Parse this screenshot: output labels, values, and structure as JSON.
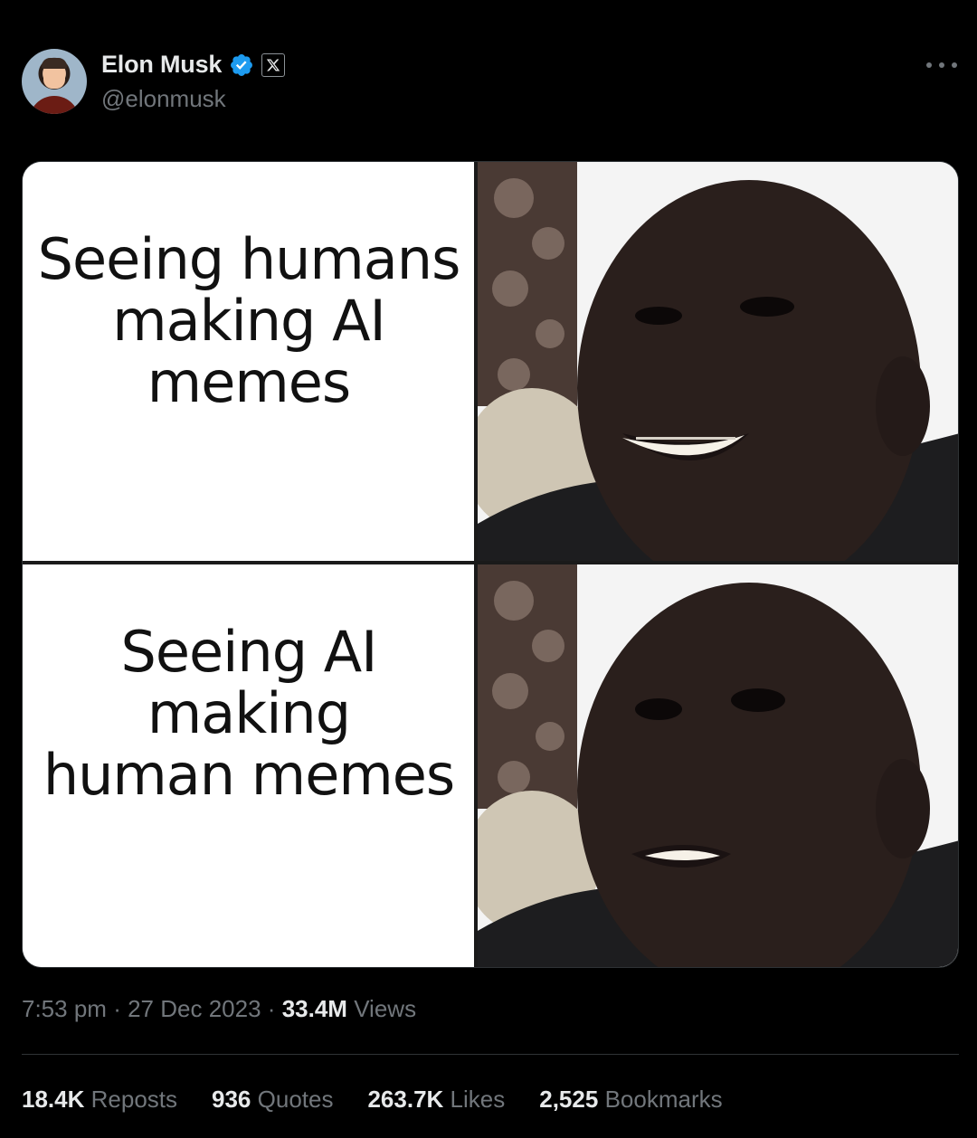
{
  "author": {
    "name": "Elon Musk",
    "handle": "@elonmusk",
    "verified_color": "#1d9bf0",
    "affiliate_badge": "𝕏"
  },
  "media": {
    "panels": [
      {
        "caption": "Seeing humans making AI memes",
        "lines": [
          "Seeing humans",
          "making AI",
          "memes"
        ],
        "expression": "smiling"
      },
      {
        "caption": "Seeing AI making human memes",
        "lines": [
          "Seeing AI",
          "making",
          "human memes"
        ],
        "expression": "worried"
      }
    ]
  },
  "meta": {
    "time": "7:53 pm",
    "date": "27 Dec 2023",
    "views_count": "33.4M",
    "views_label": "Views",
    "dot": "·"
  },
  "stats": [
    {
      "count": "18.4K",
      "label": "Reposts"
    },
    {
      "count": "936",
      "label": "Quotes"
    },
    {
      "count": "263.7K",
      "label": "Likes"
    },
    {
      "count": "2,525",
      "label": "Bookmarks"
    }
  ],
  "icons": {
    "more": "more-options-icon",
    "verified": "verified-badge-icon",
    "x": "x-logo-icon"
  }
}
